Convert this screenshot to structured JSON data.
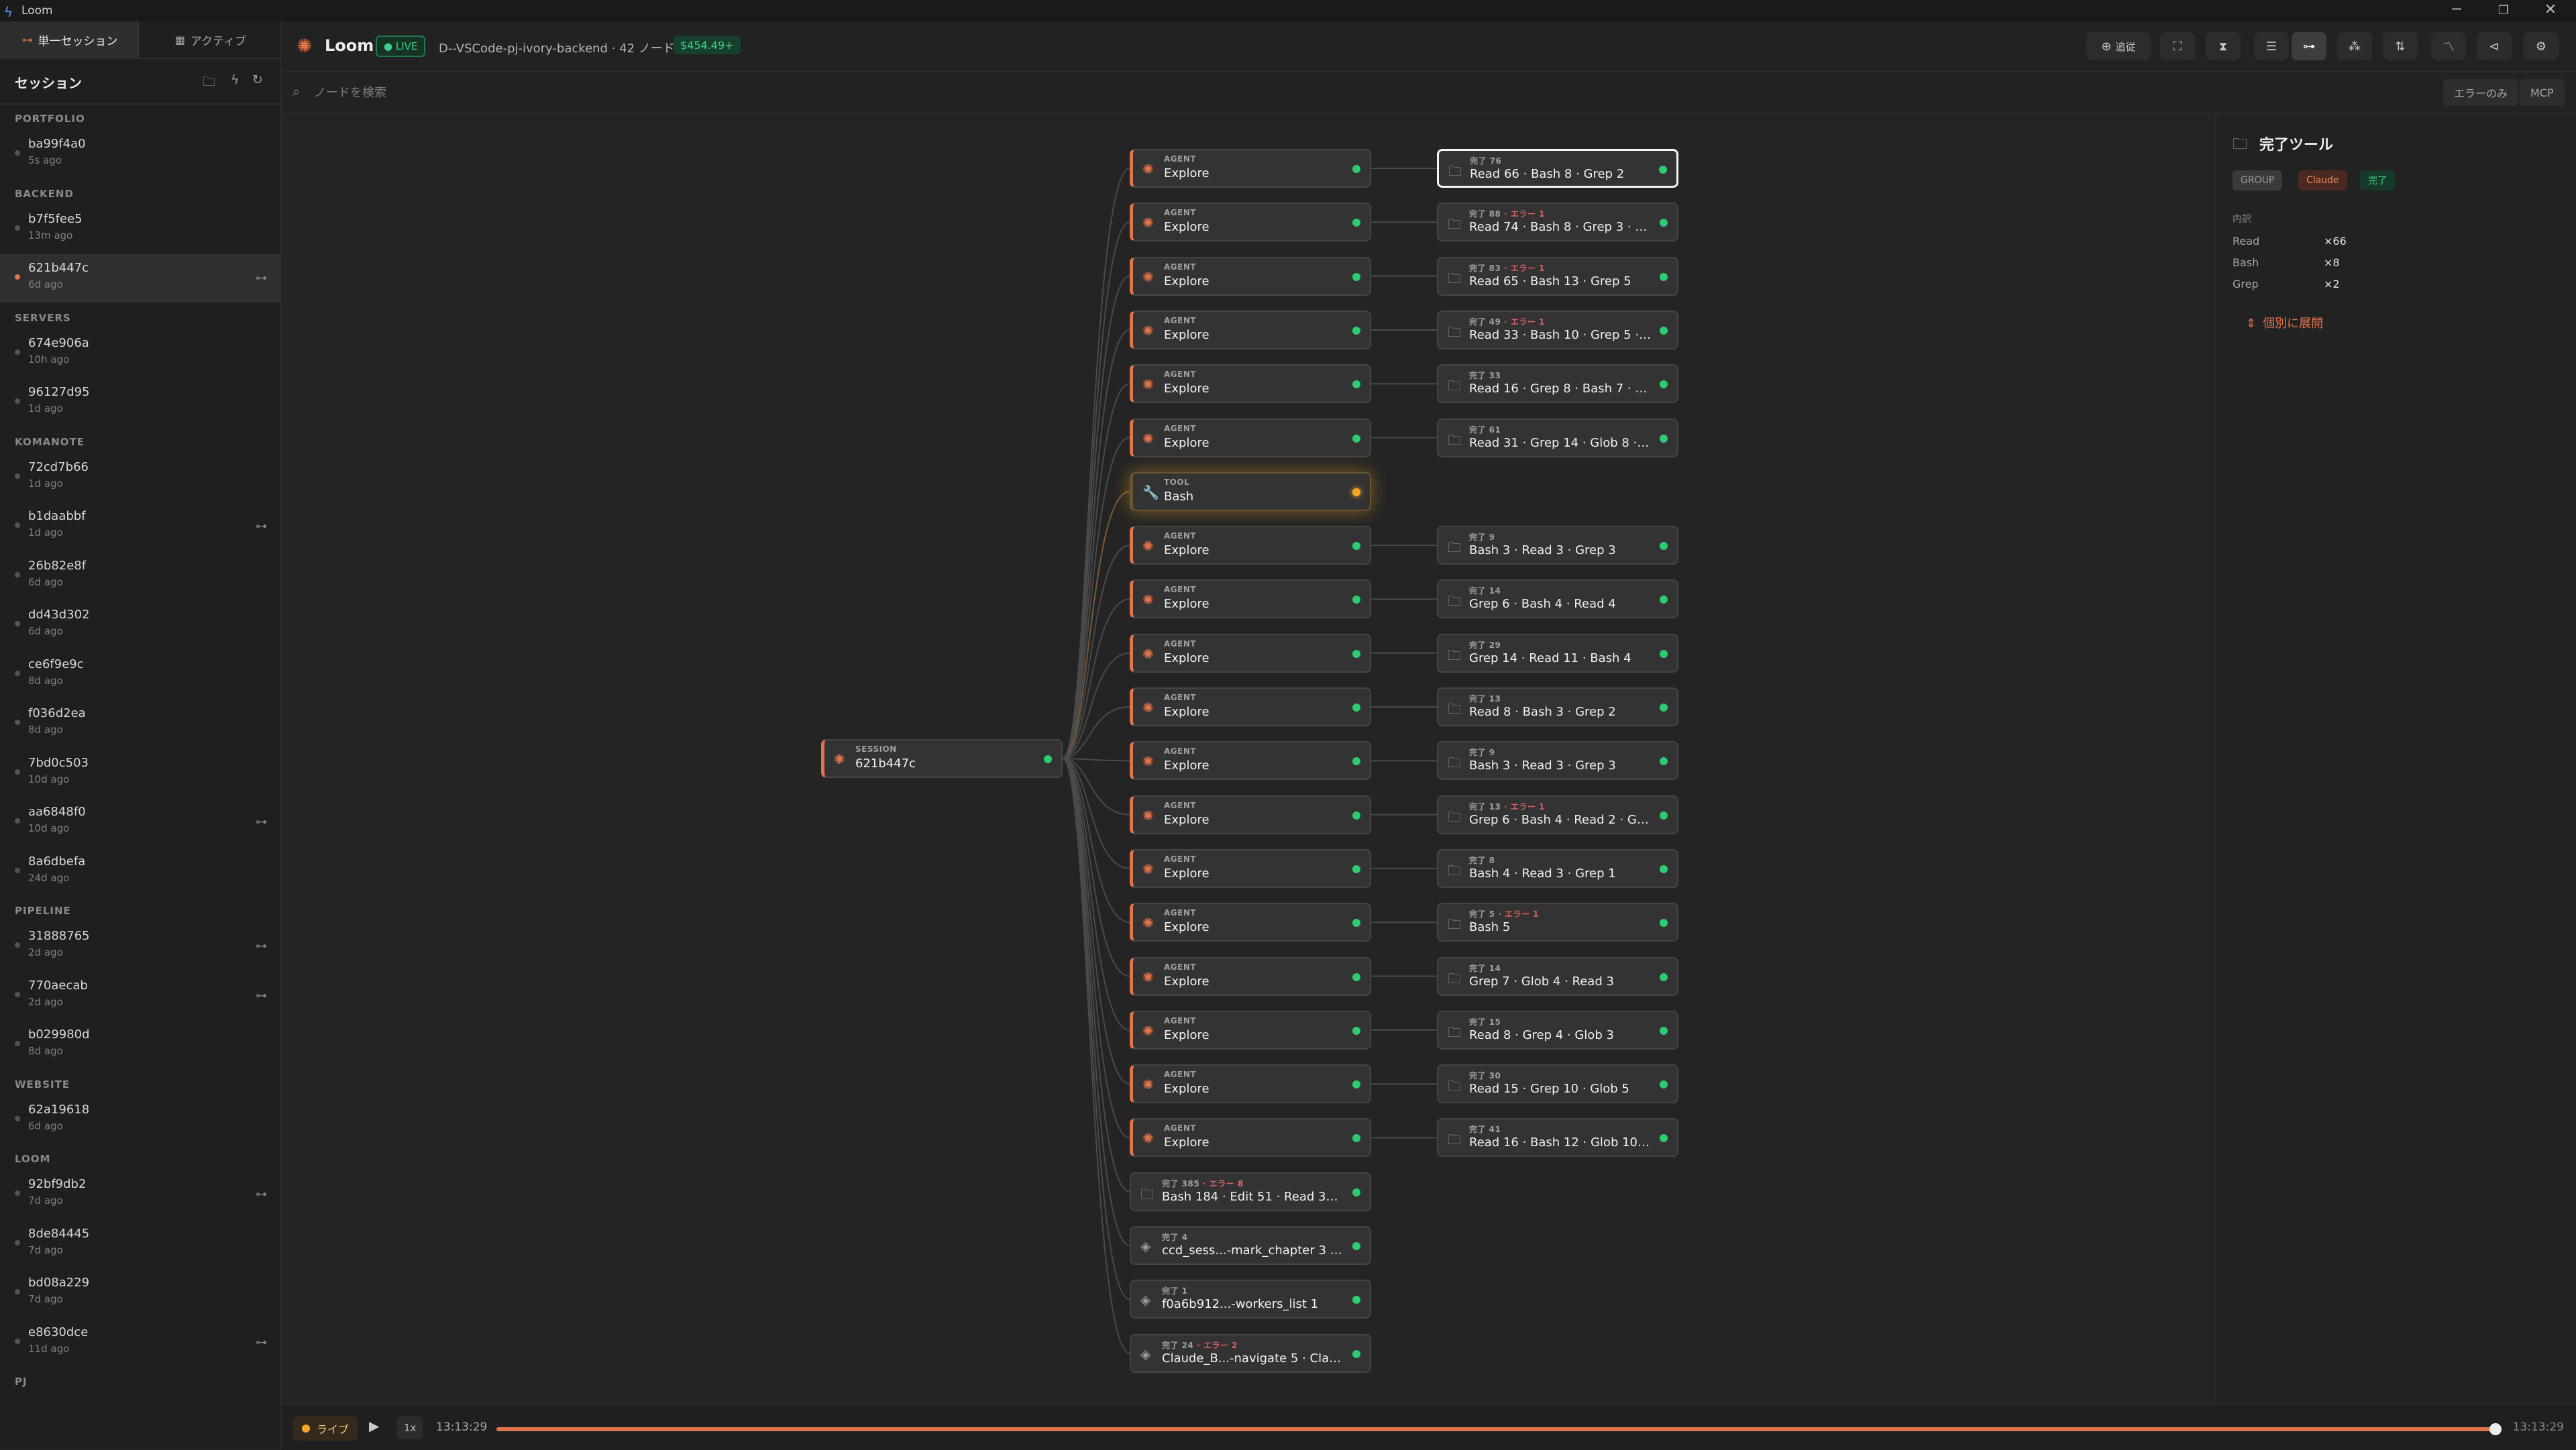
{
  "window": {
    "title": "Loom",
    "icon": "lightning-icon",
    "controls": [
      "─",
      "❐",
      "✕"
    ]
  },
  "sidebar": {
    "mode_tabs": [
      {
        "label": "単一セッション",
        "icon": "tree-icon"
      },
      {
        "label": "アクティブ",
        "icon": "grid-icon"
      }
    ],
    "header_title": "セッション",
    "header_icons": [
      "folder-icon",
      "bolt-icon",
      "refresh-icon"
    ],
    "groups": [
      {
        "label": "PORTFOLIO",
        "items": [
          {
            "id": "ba99f4a0",
            "ago": "5s ago",
            "tree": false,
            "active": false
          }
        ]
      },
      {
        "label": "BACKEND",
        "items": [
          {
            "id": "b7f5fee5",
            "ago": "13m ago",
            "tree": false,
            "active": false
          },
          {
            "id": "621b447c",
            "ago": "6d ago",
            "tree": true,
            "active": true
          }
        ]
      },
      {
        "label": "SERVERS",
        "items": [
          {
            "id": "674e906a",
            "ago": "10h ago",
            "tree": false,
            "active": false
          },
          {
            "id": "96127d95",
            "ago": "1d ago",
            "tree": false,
            "active": false
          }
        ]
      },
      {
        "label": "KOMANOTE",
        "items": [
          {
            "id": "72cd7b66",
            "ago": "1d ago",
            "tree": false,
            "active": false
          },
          {
            "id": "b1daabbf",
            "ago": "1d ago",
            "tree": true,
            "active": false
          },
          {
            "id": "26b82e8f",
            "ago": "6d ago",
            "tree": false,
            "active": false
          },
          {
            "id": "dd43d302",
            "ago": "6d ago",
            "tree": false,
            "active": false
          },
          {
            "id": "ce6f9e9c",
            "ago": "8d ago",
            "tree": false,
            "active": false
          },
          {
            "id": "f036d2ea",
            "ago": "8d ago",
            "tree": false,
            "active": false
          },
          {
            "id": "7bd0c503",
            "ago": "10d ago",
            "tree": false,
            "active": false
          },
          {
            "id": "aa6848f0",
            "ago": "10d ago",
            "tree": true,
            "active": false
          },
          {
            "id": "8a6dbefa",
            "ago": "24d ago",
            "tree": false,
            "active": false
          }
        ]
      },
      {
        "label": "PIPELINE",
        "items": [
          {
            "id": "31888765",
            "ago": "2d ago",
            "tree": true,
            "active": false
          },
          {
            "id": "770aecab",
            "ago": "2d ago",
            "tree": true,
            "active": false
          },
          {
            "id": "b029980d",
            "ago": "8d ago",
            "tree": false,
            "active": false
          }
        ]
      },
      {
        "label": "WEBSITE",
        "items": [
          {
            "id": "62a19618",
            "ago": "6d ago",
            "tree": false,
            "active": false
          }
        ]
      },
      {
        "label": "LOOM",
        "items": [
          {
            "id": "92bf9db2",
            "ago": "7d ago",
            "tree": true,
            "active": false
          },
          {
            "id": "8de84445",
            "ago": "7d ago",
            "tree": false,
            "active": false
          },
          {
            "id": "bd08a229",
            "ago": "7d ago",
            "tree": false,
            "active": false
          },
          {
            "id": "e8630dce",
            "ago": "11d ago",
            "tree": true,
            "active": false
          }
        ]
      },
      {
        "label": "PJ",
        "items": []
      }
    ]
  },
  "header": {
    "app_name": "Loom",
    "live_badge": "● LIVE",
    "path": "D--VSCode-pj-ivory-backend",
    "node_count": "· 42 ノード",
    "cost": "$454.49+",
    "follow_label": "追従",
    "toolbar_icons": [
      "target-icon",
      "fit-icon",
      "collapse-icon",
      "list-icon",
      "tree-view-icon",
      "cluster-icon",
      "sort-icon",
      "chart-icon",
      "share-icon",
      "gear-icon"
    ]
  },
  "search": {
    "placeholder": "ノードを検索",
    "filter_errors": "エラーのみ",
    "filter_mcp": "MCP"
  },
  "graph": {
    "session": {
      "kind": "SESSION",
      "label": "621b447c"
    },
    "rows": [
      {
        "kind": "AGENT",
        "label": "Explore",
        "status": "done",
        "child": {
          "count": "完了 76",
          "err": "",
          "label": "Read 66 · Bash 8 · Grep 2",
          "selected": true
        }
      },
      {
        "kind": "AGENT",
        "label": "Explore",
        "status": "done",
        "child": {
          "count": "完了 88",
          "err": "· エラー 1",
          "label": "Read 74 · Bash 8 · Grep 3 · Gl..."
        }
      },
      {
        "kind": "AGENT",
        "label": "Explore",
        "status": "done",
        "child": {
          "count": "完了 83",
          "err": "· エラー 1",
          "label": "Read 65 · Bash 13 · Grep 5"
        }
      },
      {
        "kind": "AGENT",
        "label": "Explore",
        "status": "done",
        "child": {
          "count": "完了 49",
          "err": "· エラー 1",
          "label": "Read 33 · Bash 10 · Grep 5 · Gl..."
        }
      },
      {
        "kind": "AGENT",
        "label": "Explore",
        "status": "done",
        "child": {
          "count": "完了 33",
          "err": "",
          "label": "Read 16 · Grep 8 · Bash 7 · Glo..."
        }
      },
      {
        "kind": "AGENT",
        "label": "Explore",
        "status": "done",
        "child": {
          "count": "完了 61",
          "err": "",
          "label": "Read 31 · Grep 14 · Glob 8 · Ba..."
        }
      },
      {
        "kind": "TOOL",
        "label": "Bash",
        "status": "running",
        "child": null
      },
      {
        "kind": "AGENT",
        "label": "Explore",
        "status": "done",
        "child": {
          "count": "完了 9",
          "err": "",
          "label": "Bash 3 · Read 3 · Grep 3"
        }
      },
      {
        "kind": "AGENT",
        "label": "Explore",
        "status": "done",
        "child": {
          "count": "完了 14",
          "err": "",
          "label": "Grep 6 · Bash 4 · Read 4"
        }
      },
      {
        "kind": "AGENT",
        "label": "Explore",
        "status": "done",
        "child": {
          "count": "完了 29",
          "err": "",
          "label": "Grep 14 · Read 11 · Bash 4"
        }
      },
      {
        "kind": "AGENT",
        "label": "Explore",
        "status": "done",
        "child": {
          "count": "完了 13",
          "err": "",
          "label": "Read 8 · Bash 3 · Grep 2"
        }
      },
      {
        "kind": "AGENT",
        "label": "Explore",
        "status": "done",
        "child": {
          "count": "完了 9",
          "err": "",
          "label": "Bash 3 · Read 3 · Grep 3"
        }
      },
      {
        "kind": "AGENT",
        "label": "Explore",
        "status": "done",
        "child": {
          "count": "完了 13",
          "err": "· エラー 1",
          "label": "Grep 6 · Bash 4 · Read 2 · Glo..."
        }
      },
      {
        "kind": "AGENT",
        "label": "Explore",
        "status": "done",
        "child": {
          "count": "完了 8",
          "err": "",
          "label": "Bash 4 · Read 3 · Grep 1"
        }
      },
      {
        "kind": "AGENT",
        "label": "Explore",
        "status": "done",
        "child": {
          "count": "完了 5",
          "err": "· エラー 1",
          "label": "Bash 5"
        }
      },
      {
        "kind": "AGENT",
        "label": "Explore",
        "status": "done",
        "child": {
          "count": "完了 14",
          "err": "",
          "label": "Grep 7 · Glob 4 · Read 3"
        }
      },
      {
        "kind": "AGENT",
        "label": "Explore",
        "status": "done",
        "child": {
          "count": "完了 15",
          "err": "",
          "label": "Read 8 · Grep 4 · Glob 3"
        }
      },
      {
        "kind": "AGENT",
        "label": "Explore",
        "status": "done",
        "child": {
          "count": "完了 30",
          "err": "",
          "label": "Read 15 · Grep 10 · Glob 5"
        }
      },
      {
        "kind": "AGENT",
        "label": "Explore",
        "status": "done",
        "child": {
          "count": "完了 41",
          "err": "",
          "label": "Read 16 · Bash 12 · Glob 10 · G..."
        }
      },
      {
        "kind": "GROUP",
        "count": "完了 385",
        "err": "· エラー 8",
        "label": "Bash 184 · Edit 51 · Read 37 · T...",
        "icon": "folder-icon",
        "status": "done",
        "child": null
      },
      {
        "kind": "GROUP",
        "count": "完了 4",
        "err": "",
        "label": "ccd_sess...-mark_chapter 3 · c...",
        "icon": "mcp-icon",
        "status": "done",
        "child": null
      },
      {
        "kind": "GROUP",
        "count": "完了 1",
        "err": "",
        "label": "f0a6b912...-workers_list 1",
        "icon": "mcp-icon",
        "status": "done",
        "child": null
      },
      {
        "kind": "GROUP",
        "count": "完了 24",
        "err": "· エラー 2",
        "label": "Claude_B...-navigate 5 · Claud...",
        "icon": "mcp-icon",
        "status": "done",
        "child": null
      }
    ]
  },
  "details": {
    "title": "完了ツール",
    "tags": [
      {
        "label": "GROUP",
        "color": "#9a9a9a",
        "bg": "#3a3a3a"
      },
      {
        "label": "Claude",
        "color": "#f08a5d",
        "bg": "#4a2a20"
      },
      {
        "label": "完了",
        "color": "#3ecf8e",
        "bg": "#163a28"
      }
    ],
    "section": "内訳",
    "rows": [
      {
        "k": "Read",
        "v": "×66"
      },
      {
        "k": "Bash",
        "v": "×8"
      },
      {
        "k": "Grep",
        "v": "×2"
      }
    ],
    "expand": "個別に展開"
  },
  "timeline": {
    "live": "ライブ",
    "speed": "1x",
    "start": "13:13:29",
    "end": "13:13:29",
    "progress": 1.0
  }
}
